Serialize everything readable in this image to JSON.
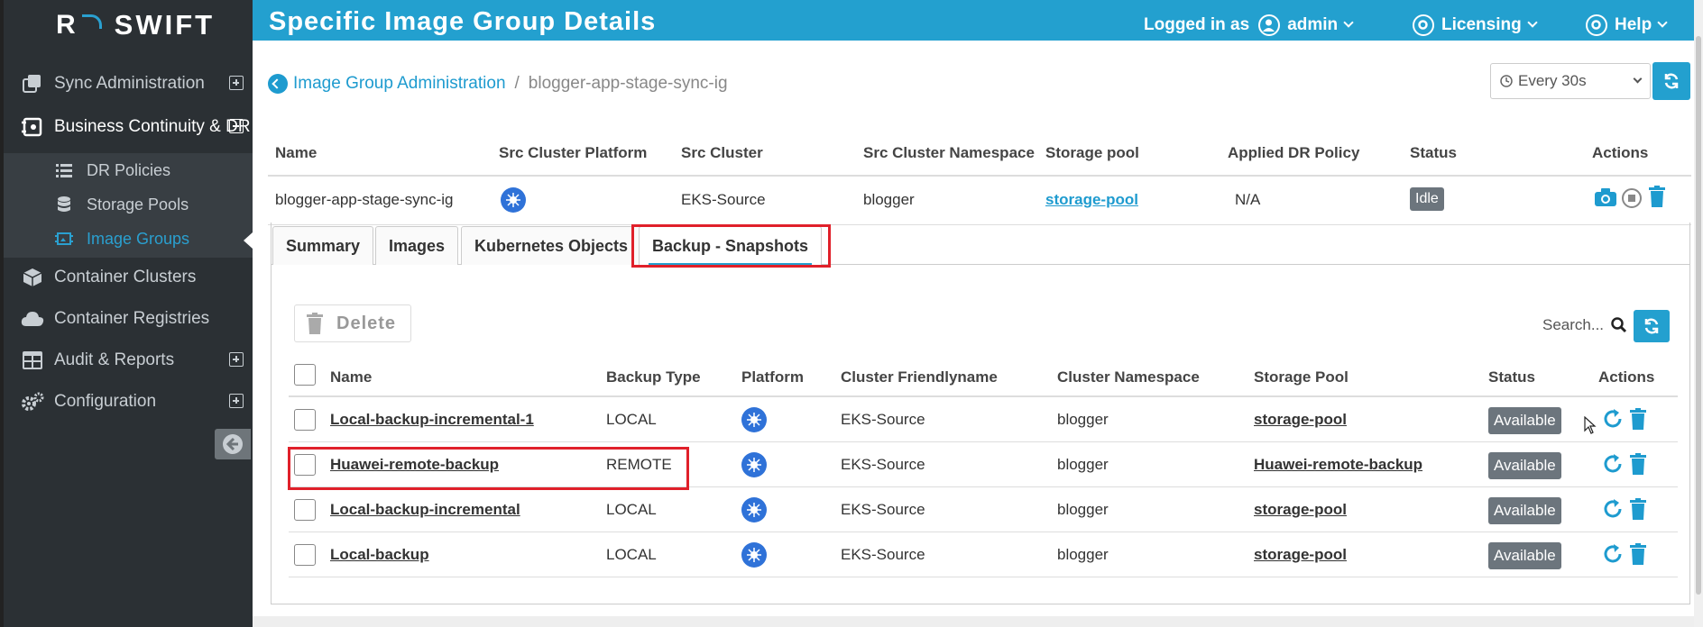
{
  "app": {
    "logo": "SWIFT",
    "logo_r": "R"
  },
  "header": {
    "title": "Specific Image Group Details",
    "logged_in_as": "Logged in as",
    "user": "admin",
    "licensing": "Licensing",
    "help": "Help"
  },
  "sidebar": {
    "items": [
      {
        "label": "Sync Administration",
        "icon": "copy-icon"
      },
      {
        "label": "Business Continuity & DR",
        "icon": "business-continuity-icon"
      },
      {
        "label": "Container Clusters",
        "icon": "cube-icon"
      },
      {
        "label": "Container Registries",
        "icon": "cloud-icon"
      },
      {
        "label": "Audit & Reports",
        "icon": "table-icon"
      },
      {
        "label": "Configuration",
        "icon": "cogs-icon"
      }
    ],
    "submenu": [
      {
        "label": "DR Policies",
        "icon": "list-icon"
      },
      {
        "label": "Storage Pools",
        "icon": "database-icon"
      },
      {
        "label": "Image Groups",
        "icon": "image-group-icon"
      }
    ]
  },
  "breadcrumb": {
    "parent": "Image Group Administration",
    "separator": "/",
    "current": "blogger-app-stage-sync-ig"
  },
  "refresh": {
    "interval": "Every 30s"
  },
  "group_table": {
    "headers": [
      "Name",
      "Src Cluster Platform",
      "Src Cluster",
      "Src Cluster Namespace",
      "Storage pool",
      "Applied DR Policy",
      "Status",
      "Actions"
    ],
    "row": {
      "name": "blogger-app-stage-sync-ig",
      "src_cluster": "EKS-Source",
      "namespace": "blogger",
      "storage_pool": "storage-pool",
      "dr_policy": "N/A",
      "status": "Idle"
    }
  },
  "tabs": [
    "Summary",
    "Images",
    "Kubernetes Objects",
    "Backup - Snapshots"
  ],
  "snapshots": {
    "delete_label": "Delete",
    "search_placeholder": "Search...",
    "headers": [
      "Name",
      "Backup Type",
      "Platform",
      "Cluster Friendlyname",
      "Cluster Namespace",
      "Storage Pool",
      "Status",
      "Actions"
    ],
    "rows": [
      {
        "name": "Local-backup-incremental-1",
        "type": "LOCAL",
        "cluster": "EKS-Source",
        "namespace": "blogger",
        "pool": "storage-pool",
        "status": "Available"
      },
      {
        "name": "Huawei-remote-backup",
        "type": "REMOTE",
        "cluster": "EKS-Source",
        "namespace": "blogger",
        "pool": "Huawei-remote-backup",
        "status": "Available"
      },
      {
        "name": "Local-backup-incremental",
        "type": "LOCAL",
        "cluster": "EKS-Source",
        "namespace": "blogger",
        "pool": "storage-pool",
        "status": "Available"
      },
      {
        "name": "Local-backup",
        "type": "LOCAL",
        "cluster": "EKS-Source",
        "namespace": "blogger",
        "pool": "storage-pool",
        "status": "Available"
      }
    ]
  },
  "colors": {
    "accent": "#23a0cf",
    "sidebar": "#2b3034",
    "highlight": "#e0202a",
    "badge": "#6c757d",
    "k8s": "#2f72d8"
  }
}
